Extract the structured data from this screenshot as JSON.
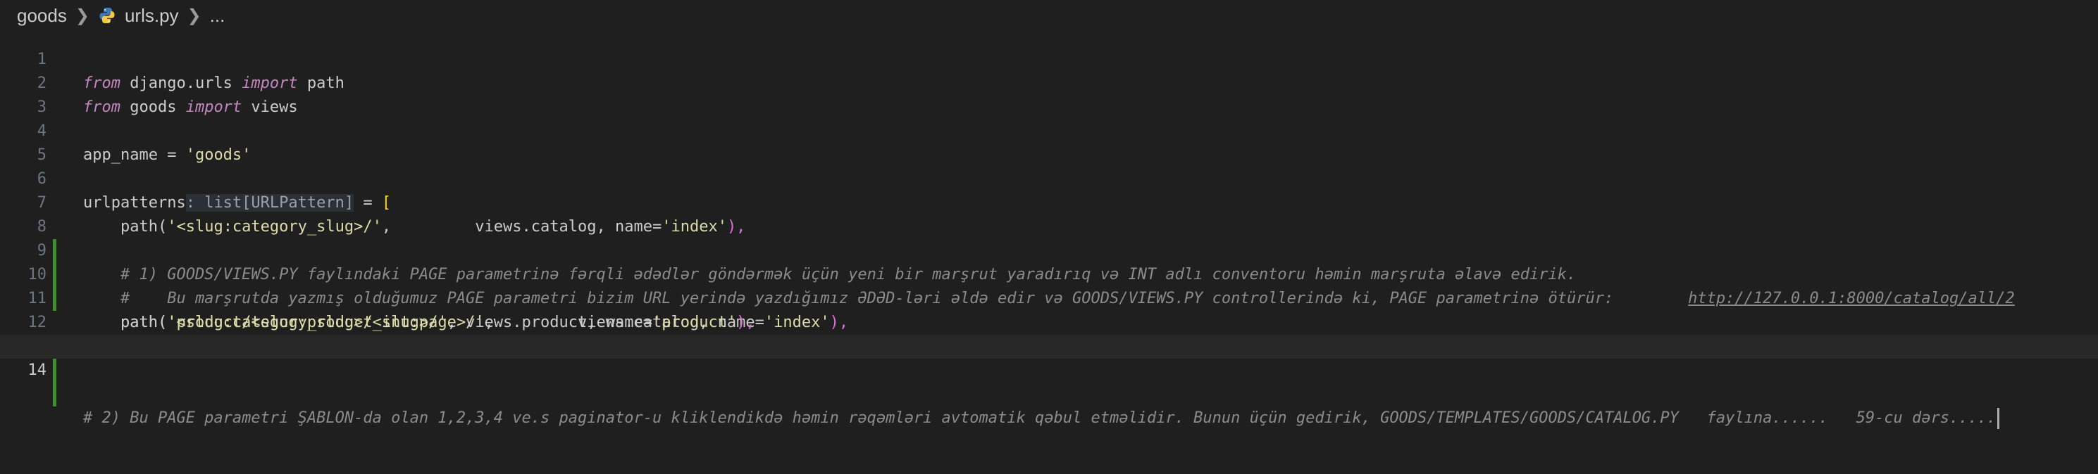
{
  "breadcrumb": {
    "folder": "goods",
    "file": "urls.py",
    "more": "..."
  },
  "icons": {
    "file_icon": "python-icon",
    "separator_icon": "chevron-right-icon"
  },
  "colors": {
    "background": "#1f1f1f",
    "keyword": "#c586c0",
    "string": "#ce9178",
    "comment": "#8b8b8b",
    "modified_gutter": "#3f8f2f"
  },
  "editor": {
    "current_line": "14",
    "lines": [
      {
        "n": "1",
        "t": {
          "kw1": "from",
          "mod": " django.urls ",
          "kw2": "import",
          "name": " path"
        }
      },
      {
        "n": "2",
        "t": {
          "kw1": "from",
          "mod": " goods ",
          "kw2": "import",
          "name": " views"
        }
      },
      {
        "n": "3"
      },
      {
        "n": "4",
        "t": {
          "a": "app_name = ",
          "s": "'goods'"
        }
      },
      {
        "n": "5"
      },
      {
        "n": "6",
        "t": {
          "a": "urlpatterns",
          "hint": ": list[URLPattern]",
          "b": " = ",
          "br": "["
        }
      },
      {
        "n": "7",
        "t": {
          "a": "    path(",
          "s1": "'<slug:category_slug>/'",
          "b": ",         views.catalog, name=",
          "s2": "'index'",
          "c": "),"
        }
      },
      {
        "n": "8",
        "t": {
          "cm": "    # 1) GOODS/VIEWS.PY faylındaki PAGE parametrinə fərqli ədədlər göndərmək üçün yeni bir marşrut yaradırıq və INT adlı conventoru həmin marşruta əlavə edirik."
        }
      },
      {
        "n": "9",
        "t": {
          "cm": "    #    Bu marşrutda yazmış olduğumuz PAGE parametri bizim URL yerində yazdığımız ƏDƏD-ləri əldə edir və GOODS/VIEWS.PY controllerində ki, PAGE parametrinə ötürür:        ",
          "url": "http://127.0.0.1:8000/catalog/all/2"
        }
      },
      {
        "n": "10",
        "t": {
          "a": "    path(",
          "s1": "'<slug:category_slug>/<int:page>/'",
          "b": ",         views.catalog, name=",
          "s2": "'index'",
          "c": "),"
        }
      },
      {
        "n": "11",
        "t": {
          "a": "    path(",
          "s1": "'product/<slug:product_slug>/'",
          "b": ", views.product, name=",
          "s2": "'product'",
          "c": "),"
        }
      },
      {
        "n": "12",
        "t": {
          "br": "]"
        }
      },
      {
        "n": "13"
      },
      {
        "n": "14",
        "t": {
          "cm": "# 2) Bu PAGE parametri ŞABLON-da olan 1,2,3,4 ve.s paginator-u kliklendikdə həmin rəqəmləri avtomatik qəbul etməlidir. Bunun üçün gedirik, GOODS/TEMPLATES/GOODS/CATALOG.PY   faylına......   59-cu dərs....."
        }
      }
    ]
  }
}
